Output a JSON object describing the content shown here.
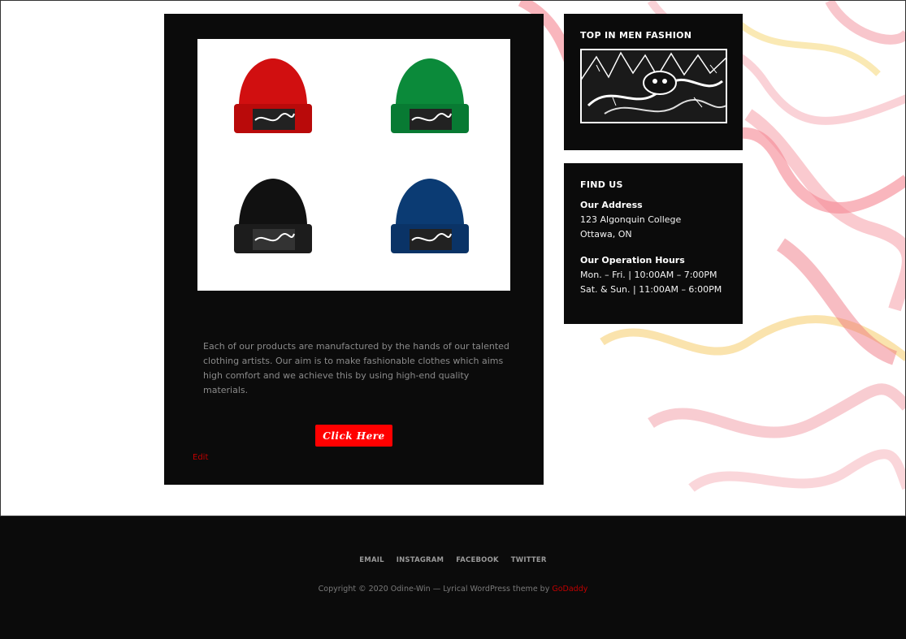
{
  "main": {
    "image_alt": "Four beanies in red, green, black and blue",
    "beanie_colors": [
      "#d10f10",
      "#0b8a3a",
      "#111111",
      "#0b3b73"
    ],
    "description": "Each of our products are manufactured by the hands of our talented clothing artists. Our aim is to make fashionable clothes which aims high comfort and we achieve this by using high-end quality materials.",
    "cta_label": "Click Here",
    "edit_label": "Edit"
  },
  "sidebar": {
    "widget1_title": "TOP IN MEN FASHION",
    "widget2_title": "FIND US",
    "address_label": "Our Address",
    "address_line1": "123 Algonquin College",
    "address_line2": "Ottawa, ON",
    "hours_label": "Our Operation Hours",
    "hours_line1": "Mon. – Fri. | 10:00AM – 7:00PM",
    "hours_line2": "Sat. & Sun. | 11:00AM – 6:00PM"
  },
  "footer": {
    "nav": [
      "EMAIL",
      "INSTAGRAM",
      "FACEBOOK",
      "TWITTER"
    ],
    "copyright_text": "Copyright © 2020 Odine-Win — Lyrical WordPress theme by ",
    "copyright_link": "GoDaddy"
  },
  "colors": {
    "accent": "#ff0000",
    "dark": "#0b0b0b",
    "link": "#c00000"
  }
}
